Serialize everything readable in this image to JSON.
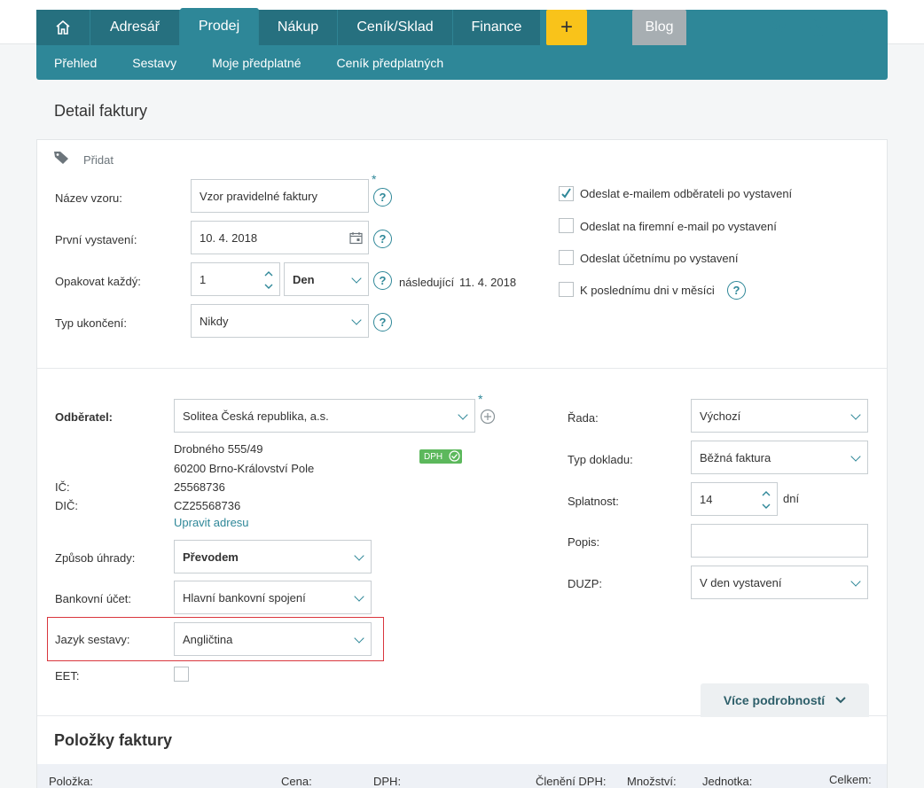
{
  "nav": {
    "tabs": [
      {
        "label": "Adresář"
      },
      {
        "label": "Prodej"
      },
      {
        "label": "Nákup"
      },
      {
        "label": "Ceník/Sklad"
      },
      {
        "label": "Finance"
      }
    ],
    "plus": "+",
    "blog": "Blog",
    "subtabs": [
      "Přehled",
      "Sestavy",
      "Moje předplatné",
      "Ceník předplatných"
    ]
  },
  "page_title": "Detail faktury",
  "tags": {
    "add_label": "Přidat"
  },
  "form_top": {
    "template_name_label": "Název vzoru:",
    "template_name_value": "Vzor pravidelné faktury",
    "first_issue_label": "První vystavení:",
    "first_issue_value": "10. 4. 2018",
    "repeat_label": "Opakovat každý:",
    "repeat_value": "1",
    "repeat_unit": "Den",
    "next_label": "následující",
    "next_date": "11. 4. 2018",
    "end_type_label": "Typ ukončení:",
    "end_type_value": "Nikdy",
    "required_mark": "*"
  },
  "checkboxes": [
    {
      "label": "Odeslat e-mailem odběrateli po vystavení",
      "checked": true
    },
    {
      "label": "Odeslat na firemní e-mail po vystavení",
      "checked": false
    },
    {
      "label": "Odeslat účetnímu po vystavení",
      "checked": false
    },
    {
      "label": "K poslednímu dni v měsíci",
      "checked": false
    }
  ],
  "customer": {
    "label": "Odběratel:",
    "value": "Solitea Česká republika, a.s.",
    "street": "Drobného 555/49",
    "city": "60200 Brno-Království Pole",
    "ic_label": "IČ:",
    "ic_value": "25568736",
    "dic_label": "DIČ:",
    "dic_value": "CZ25568736",
    "dph_badge": "DPH",
    "edit_address": "Upravit adresu"
  },
  "payment": {
    "method_label": "Způsob úhrady:",
    "method_value": "Převodem",
    "bank_label": "Bankovní účet:",
    "bank_value": "Hlavní bankovní spojení",
    "language_label": "Jazyk sestavy:",
    "language_value": "Angličtina",
    "eet_label": "EET:"
  },
  "right": {
    "series_label": "Řada:",
    "series_value": "Výchozí",
    "doc_type_label": "Typ dokladu:",
    "doc_type_value": "Běžná faktura",
    "due_label": "Splatnost:",
    "due_value": "14",
    "due_unit": "dní",
    "desc_label": "Popis:",
    "desc_value": "",
    "duzp_label": "DUZP:",
    "duzp_value": "V den vystavení"
  },
  "more_details": "Více podrobností",
  "items": {
    "title": "Položky faktury",
    "columns": [
      "Položka:",
      "Cena:",
      "DPH:",
      "Členění DPH:",
      "Množství:",
      "Jednotka:",
      "Celkem:"
    ]
  },
  "colors": {
    "accent": "#2e8798",
    "nav_dark": "#26707f",
    "plus": "#f9c31a",
    "highlight": "#d9363e"
  }
}
